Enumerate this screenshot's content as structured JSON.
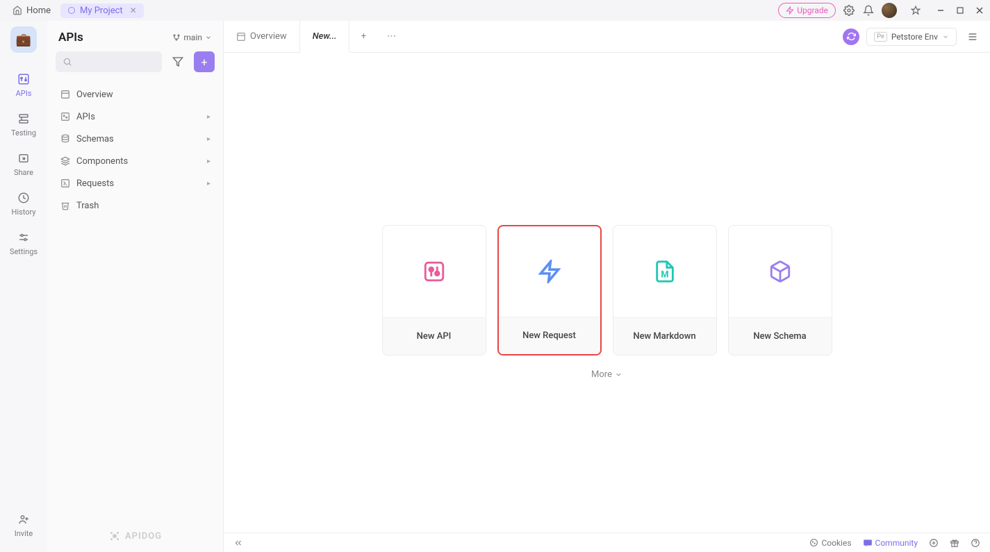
{
  "titlebar": {
    "home_label": "Home",
    "project_label": "My Project",
    "upgrade_label": "Upgrade"
  },
  "rail": {
    "apis": "APIs",
    "testing": "Testing",
    "share": "Share",
    "history": "History",
    "settings": "Settings",
    "invite": "Invite"
  },
  "left_panel": {
    "title": "APIs",
    "branch": "main",
    "tree": {
      "overview": "Overview",
      "apis": "APIs",
      "schemas": "Schemas",
      "components": "Components",
      "requests": "Requests",
      "trash": "Trash"
    },
    "footer": "APIDOG"
  },
  "tabs": {
    "overview": "Overview",
    "new": "New...",
    "env_badge": "Pe",
    "env_label": "Petstore Env"
  },
  "cards": {
    "new_api": "New API",
    "new_request": "New Request",
    "new_markdown": "New Markdown",
    "new_schema": "New Schema",
    "more": "More"
  },
  "bottom": {
    "cookies": "Cookies",
    "community": "Community"
  }
}
